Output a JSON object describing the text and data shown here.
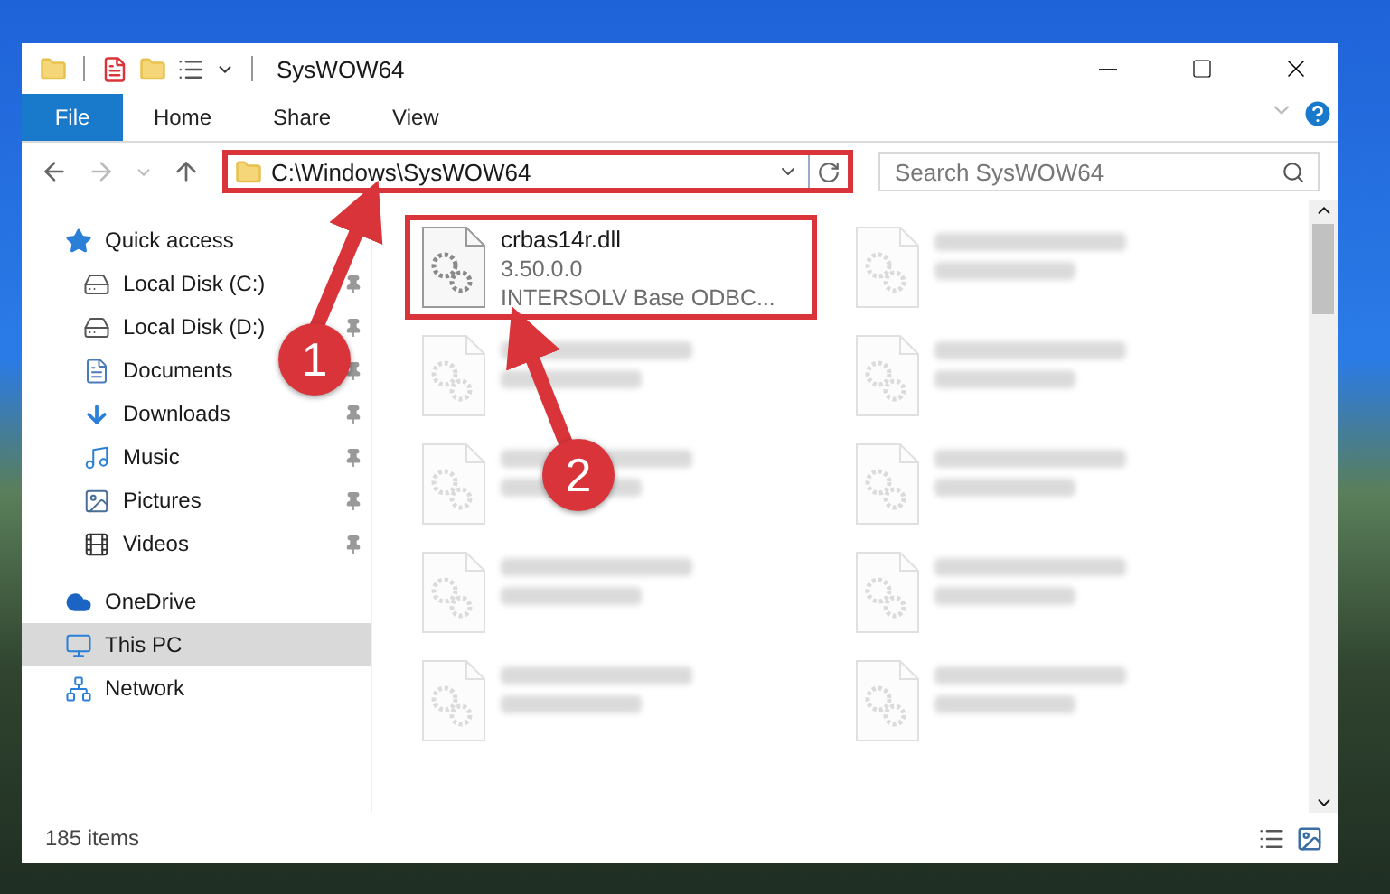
{
  "window": {
    "title": "SysWOW64"
  },
  "ribbon_tabs": [
    {
      "label": "File",
      "kind": "file",
      "selected": false
    },
    {
      "label": "Home",
      "kind": "tab",
      "selected": false
    },
    {
      "label": "Share",
      "kind": "tab",
      "selected": false
    },
    {
      "label": "View",
      "kind": "tab",
      "selected": false
    }
  ],
  "address": {
    "path": "C:\\Windows\\SysWOW64",
    "highlighted": true
  },
  "search": {
    "placeholder": "Search SysWOW64"
  },
  "nav": [
    {
      "label": "Quick access",
      "kind": "star",
      "selected": false,
      "children": [
        {
          "label": "Local Disk (C:)",
          "kind": "system-drive",
          "pinned": true,
          "selected": false
        },
        {
          "label": "Local Disk (D:)",
          "kind": "drive",
          "pinned": true,
          "selected": false
        },
        {
          "label": "Documents",
          "kind": "documents",
          "pinned": true,
          "selected": false
        },
        {
          "label": "Downloads",
          "kind": "downloads",
          "pinned": true,
          "selected": false
        },
        {
          "label": "Music",
          "kind": "music",
          "pinned": true,
          "selected": false
        },
        {
          "label": "Pictures",
          "kind": "pictures",
          "pinned": true,
          "selected": false
        },
        {
          "label": "Videos",
          "kind": "videos",
          "pinned": true,
          "selected": false
        }
      ]
    },
    {
      "label": "OneDrive",
      "kind": "cloud",
      "selected": false
    },
    {
      "label": "This PC",
      "kind": "pc",
      "selected": true
    },
    {
      "label": "Network",
      "kind": "network",
      "selected": false
    }
  ],
  "files": [
    [
      {
        "kind": "file",
        "name": "crbas14r.dll",
        "lines": [
          "3.50.0.0",
          "INTERSOLV Base ODBC..."
        ],
        "highlighted": true
      },
      {
        "kind": "blurred"
      },
      {
        "kind": "blurred"
      },
      {
        "kind": "blurred"
      },
      {
        "kind": "blurred"
      }
    ],
    [
      {
        "kind": "blurred"
      },
      {
        "kind": "blurred"
      },
      {
        "kind": "blurred"
      },
      {
        "kind": "blurred"
      },
      {
        "kind": "blurred"
      }
    ]
  ],
  "status_bar": {
    "count": "185 items"
  },
  "callouts": [
    {
      "number": "1"
    },
    {
      "number": "2"
    }
  ]
}
